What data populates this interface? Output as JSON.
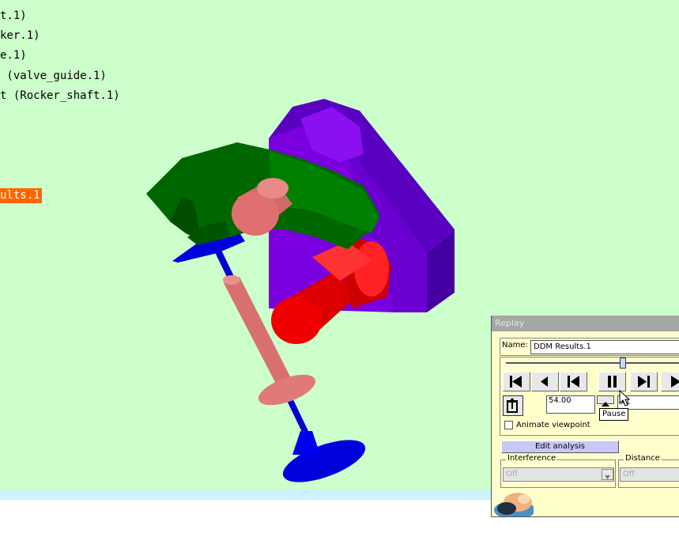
{
  "tree": {
    "lines": [
      "t.1)",
      "ker.1)",
      "e.1)",
      " (valve_guide.1)",
      "t (Rocker_shaft.1)"
    ],
    "highlighted": "ults.1"
  },
  "replay": {
    "title": "Replay",
    "name_label": "Name:",
    "name_value": "DDM Results.1",
    "slider_fraction": 0.68,
    "step_value": "54.00",
    "speed_value": "x1",
    "tooltip": "Pause",
    "animate_label": "Animate viewpoint",
    "animate_checked": false,
    "edit_button": "Edit analysis",
    "interference_label": "Interference",
    "interference_value": "Off",
    "distance_label": "Distance",
    "distance_value": "Off"
  },
  "colors": {
    "viewport_bg": "#ccffcc",
    "rocker": "#006600",
    "bracket": "#7a00e0",
    "shaft_red": "#ee0000",
    "valve_blue": "#0000dd",
    "pin_pink": "#d87070",
    "highlight": "#ff6600",
    "panel_bg": "#ffffcc"
  },
  "icons": [
    "jump-start-icon",
    "play-backward-icon",
    "step-backward-icon",
    "pause-icon",
    "step-forward-icon",
    "play-forward-icon",
    "loop-icon",
    "spin-up-icon",
    "dropdown-arrow-icon",
    "mouse-cursor-icon"
  ]
}
